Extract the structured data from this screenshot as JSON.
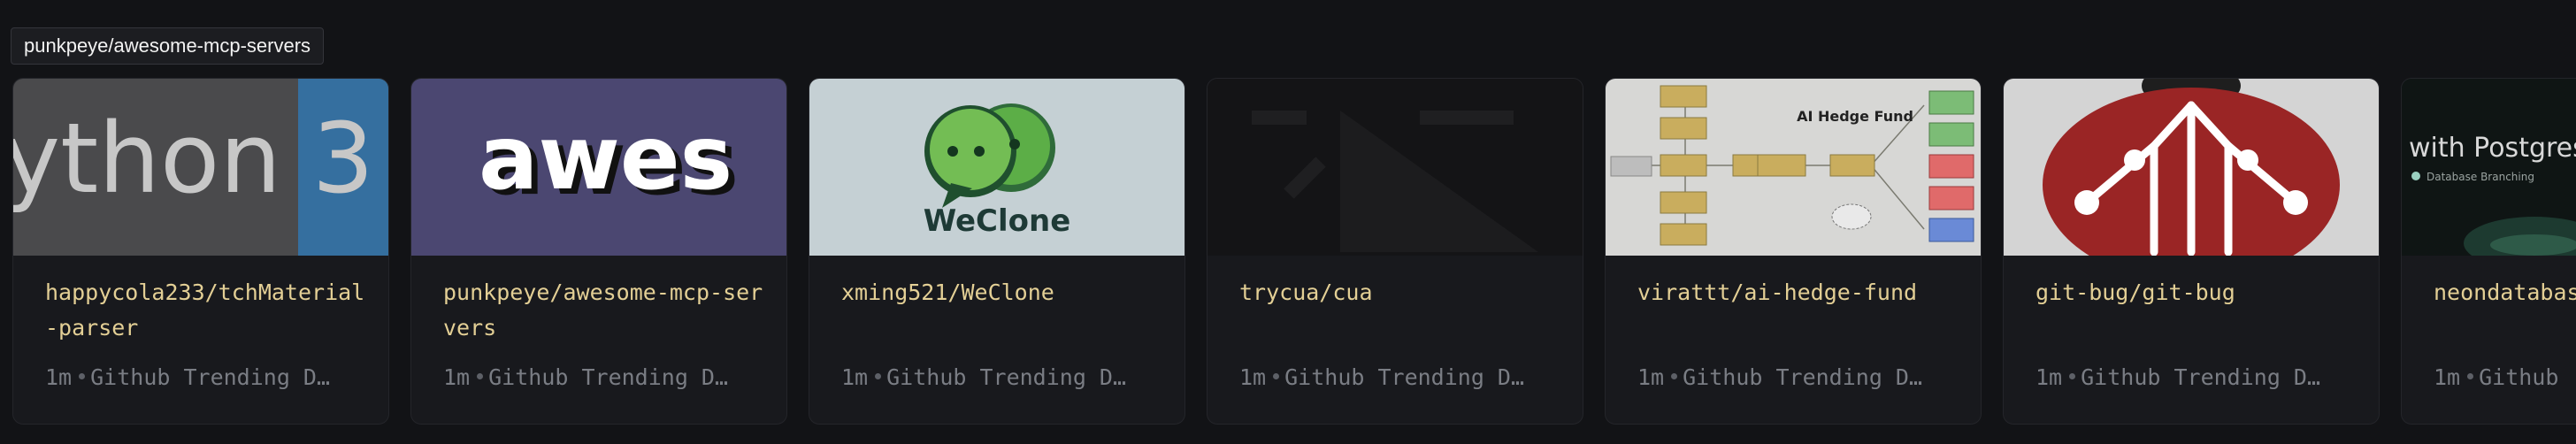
{
  "tooltip": "punkpeye/awesome-mcp-servers",
  "cards": [
    {
      "title": "happycola233/tchMaterial-parser",
      "age": "1m",
      "source": "Github Trending D…",
      "thumb_text": "ython 3"
    },
    {
      "title": "punkpeye/awesome-mcp-servers",
      "age": "1m",
      "source": "Github Trending D…",
      "thumb_text": "awes"
    },
    {
      "title": "xming521/WeClone",
      "age": "1m",
      "source": "Github Trending D…",
      "thumb_text": "WeClone"
    },
    {
      "title": "trycua/cua",
      "age": "1m",
      "source": "Github Trending D…",
      "thumb_text": ""
    },
    {
      "title": "virattt/ai-hedge-fund",
      "age": "1m",
      "source": "Github Trending D…",
      "thumb_text": "AI Hedge Fund"
    },
    {
      "title": "git-bug/git-bug",
      "age": "1m",
      "source": "Github Trending D…",
      "thumb_text": ""
    },
    {
      "title": "neondatabas",
      "age": "1m",
      "source": "Github",
      "thumb_text": "with Postgres",
      "thumb_subtext": "Database Branching"
    }
  ]
}
